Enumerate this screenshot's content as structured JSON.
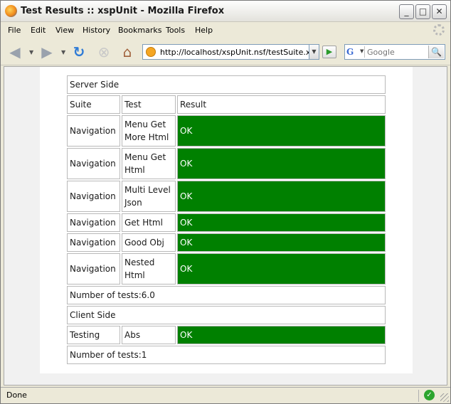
{
  "window": {
    "title": "Test Results :: xspUnit - Mozilla Firefox",
    "controls": {
      "minimize": "_",
      "maximize": "□",
      "close": "✕"
    }
  },
  "menu": [
    "File",
    "Edit",
    "View",
    "History",
    "Bookmarks",
    "Tools",
    "Help"
  ],
  "toolbar": {
    "back_icon": "back-arrow-icon",
    "forward_icon": "forward-arrow-icon",
    "reload_icon": "reload-icon",
    "stop_icon": "stop-icon",
    "home_icon": "home-icon",
    "url": "http://localhost/xspUnit.nsf/testSuite.xsp",
    "search_engine": "G",
    "search_placeholder": "Google"
  },
  "results": {
    "server_heading": "Server Side",
    "columns": {
      "suite": "Suite",
      "test": "Test",
      "result": "Result"
    },
    "server_rows": [
      {
        "suite": "Navigation",
        "test": "Menu Get More Html",
        "result": "OK"
      },
      {
        "suite": "Navigation",
        "test": "Menu Get Html",
        "result": "OK"
      },
      {
        "suite": "Navigation",
        "test": "Multi Level Json",
        "result": "OK"
      },
      {
        "suite": "Navigation",
        "test": "Get Html",
        "result": "OK"
      },
      {
        "suite": "Navigation",
        "test": "Good Obj",
        "result": "OK"
      },
      {
        "suite": "Navigation",
        "test": "Nested Html",
        "result": "OK"
      }
    ],
    "server_count": "Number of tests:6.0",
    "client_heading": "Client Side",
    "client_rows": [
      {
        "suite": "Testing",
        "test": "Abs",
        "result": "OK"
      }
    ],
    "client_count": "Number of tests:1"
  },
  "status": {
    "text": "Done"
  },
  "colors": {
    "pass": "#008000",
    "pass_text": "#ffffff",
    "border": "#b9b9b9"
  }
}
